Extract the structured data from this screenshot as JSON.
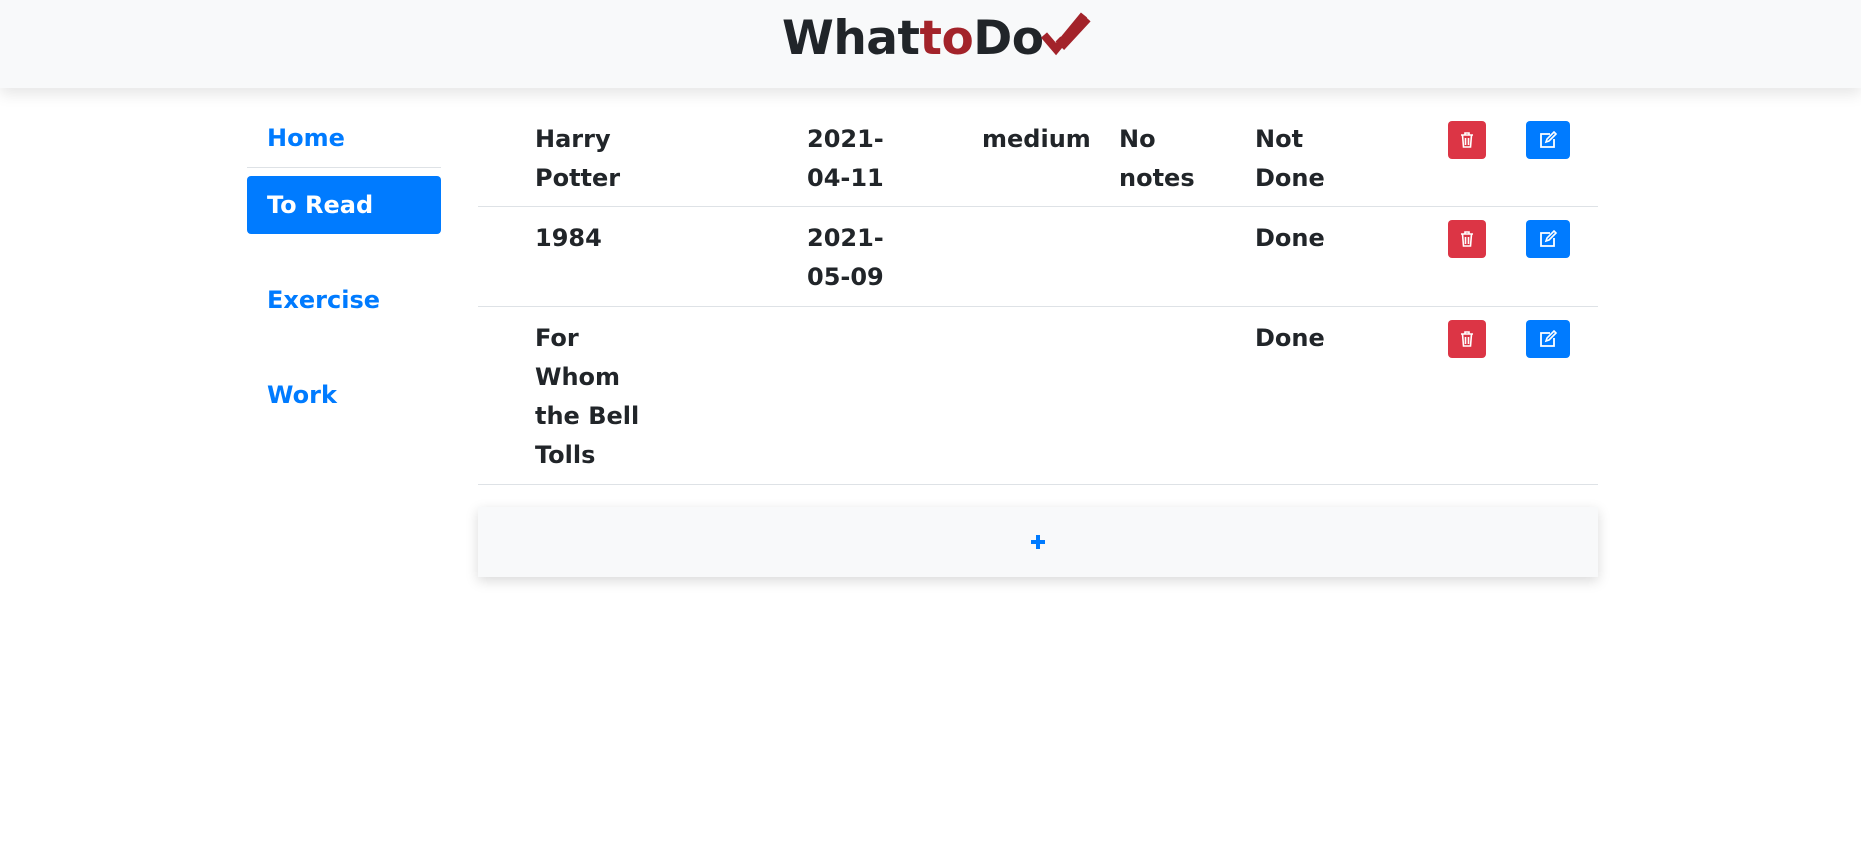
{
  "header": {
    "brand_prefix": "What",
    "brand_highlight": "to",
    "brand_suffix": "Do",
    "brand_icon": "double-check-icon",
    "brand_color": "#212529",
    "highlight_color": "#a3232a"
  },
  "sidebar": {
    "items": [
      {
        "label": "Home",
        "active": false
      },
      {
        "label": "To Read",
        "active": true
      },
      {
        "label": "Exercise",
        "active": false
      },
      {
        "label": "Work",
        "active": false
      }
    ]
  },
  "table": {
    "rows": [
      {
        "title": "Harry Potter",
        "date": "2021-04-11",
        "priority": "medium",
        "notes": "No notes",
        "status": "Not Done"
      },
      {
        "title": "1984",
        "date": "2021-05-09",
        "priority": "",
        "notes": "",
        "status": "Done"
      },
      {
        "title": "For Whom the Bell Tolls",
        "date": "",
        "priority": "",
        "notes": "",
        "status": "Done"
      }
    ],
    "delete_icon": "trash-icon",
    "edit_icon": "edit-icon"
  },
  "add_button": {
    "icon": "plus-icon"
  },
  "colors": {
    "primary": "#007bff",
    "danger": "#dc3545",
    "header_bg": "#f8f9fa"
  }
}
